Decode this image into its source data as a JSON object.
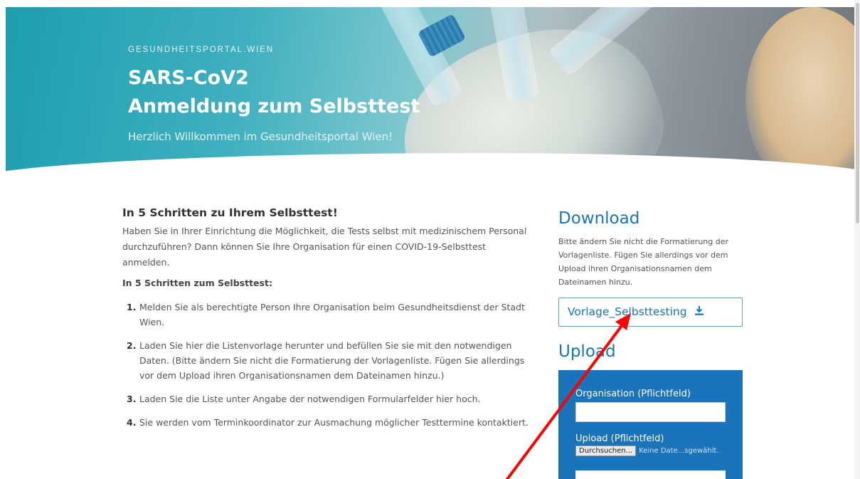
{
  "hero": {
    "brand": "GESUNDHEITSPORTAL.WIEN",
    "title_line1": "SARS-CoV2",
    "title_line2": "Anmeldung zum Selbsttest",
    "subtitle": "Herzlich Willkommen im Gesundheitsportal Wien!"
  },
  "main": {
    "heading": "In 5 Schritten zu Ihrem Selbsttest!",
    "intro": "Haben Sie in Ihrer Einrichtung die Möglichkeit, die Tests selbst mit medizinischem Personal durchzuführen? Dann können Sie Ihre Organisation für einen COVID-19-Selbsttest anmelden.",
    "steps_heading": "In 5 Schritten zum Selbsttest:",
    "steps": [
      {
        "num": "1.",
        "text": "Melden Sie als berechtigte Person Ihre Organisation beim Gesundheitsdienst der Stadt Wien."
      },
      {
        "num": "2.",
        "text": "Laden Sie hier die Listenvorlage herunter und befüllen Sie sie mit den notwendigen Daten. (Bitte ändern Sie nicht die Formatierung der Vorlagenliste. Fügen Sie allerdings vor dem Upload ihren Organisationsnamen dem Dateinamen hinzu.)"
      },
      {
        "num": "3.",
        "text": "Laden Sie die Liste unter Angabe der notwendigen Formularfelder hier hoch."
      },
      {
        "num": "4.",
        "text": "Sie werden vom Terminkoordinator zur Ausmachung möglicher Testtermine kontaktiert."
      }
    ]
  },
  "sidebar": {
    "download_heading": "Download",
    "download_note": "Bitte ändern Sie nicht die Formatierung der Vorlagenliste. Fügen Sie allerdings vor dem Upload ihren Organisationsnamen dem Dateinamen hinzu.",
    "download_button": "Vorlage_Selbsttesting",
    "download_icon": "download-icon",
    "upload_heading": "Upload",
    "org_label": "Organisation (Pflichtfeld)",
    "upload_label": "Upload (Pflichtfeld)",
    "file_button": "Durchsuchen...",
    "file_status": "Keine Date...sgewählt."
  },
  "colors": {
    "accent": "#1b73b9",
    "annotation": "#ff0000"
  }
}
